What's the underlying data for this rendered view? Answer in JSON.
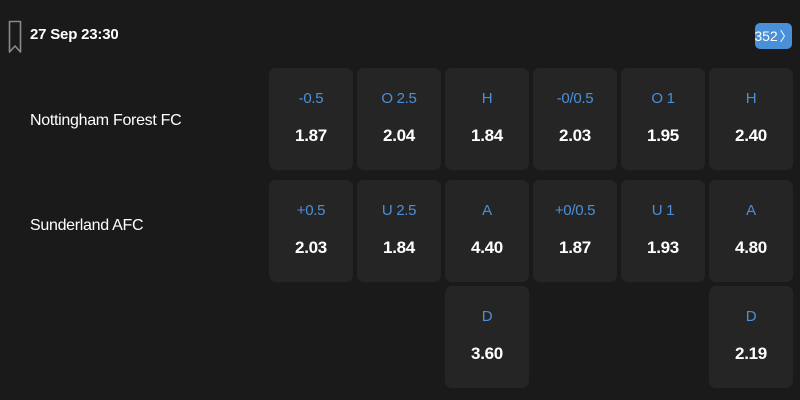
{
  "header": {
    "match_time": "27 Sep 23:30",
    "more_count": "352",
    "more_chevron": "〉"
  },
  "teams": {
    "home": "Nottingham Forest FC",
    "away": "Sunderland AFC"
  },
  "odds": {
    "home_row": [
      {
        "label": "-0.5",
        "value": "1.87"
      },
      {
        "label": "O 2.5",
        "value": "2.04"
      },
      {
        "label": "H",
        "value": "1.84"
      },
      {
        "label": "-0/0.5",
        "value": "2.03"
      },
      {
        "label": "O 1",
        "value": "1.95"
      },
      {
        "label": "H",
        "value": "2.40"
      }
    ],
    "away_row": [
      {
        "label": "+0.5",
        "value": "2.03"
      },
      {
        "label": "U 2.5",
        "value": "1.84"
      },
      {
        "label": "A",
        "value": "4.40"
      },
      {
        "label": "+0/0.5",
        "value": "1.87"
      },
      {
        "label": "U 1",
        "value": "1.93"
      },
      {
        "label": "A",
        "value": "4.80"
      }
    ],
    "draw_full_time": {
      "label": "D",
      "value": "3.60"
    },
    "draw_first_half": {
      "label": "D",
      "value": "2.19"
    }
  },
  "colors": {
    "background": "#1a1a1a",
    "cell": "#252525",
    "accent": "#4a90d9",
    "text": "#ffffff"
  },
  "icons": {
    "bookmark": "bookmark-icon",
    "chevron": "chevron-right-icon"
  }
}
